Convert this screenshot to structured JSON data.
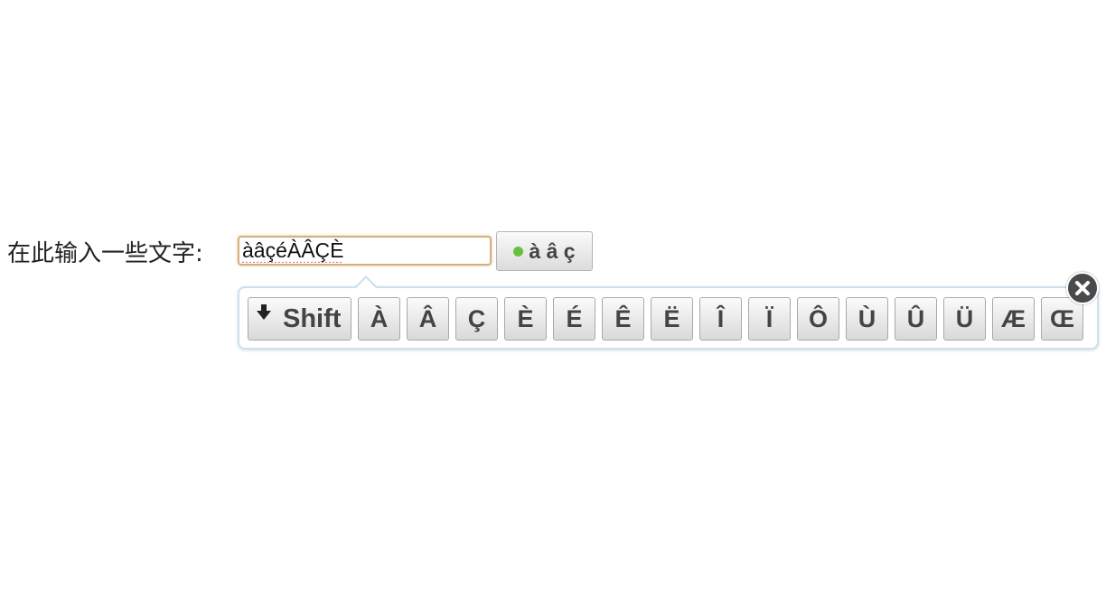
{
  "form": {
    "label": "在此输入一些文字:",
    "input_value": "àâçéÀÂÇÈ"
  },
  "toggle": {
    "label": "à â ç",
    "status_color": "#66c040"
  },
  "keyboard": {
    "shift_label": "Shift",
    "shift_icon": "down-arrow-icon",
    "close_icon": "close-icon",
    "keys": [
      "À",
      "Â",
      "Ç",
      "È",
      "É",
      "Ê",
      "Ë",
      "Î",
      "Ï",
      "Ô",
      "Ù",
      "Û",
      "Ü",
      "Æ",
      "Œ"
    ]
  }
}
